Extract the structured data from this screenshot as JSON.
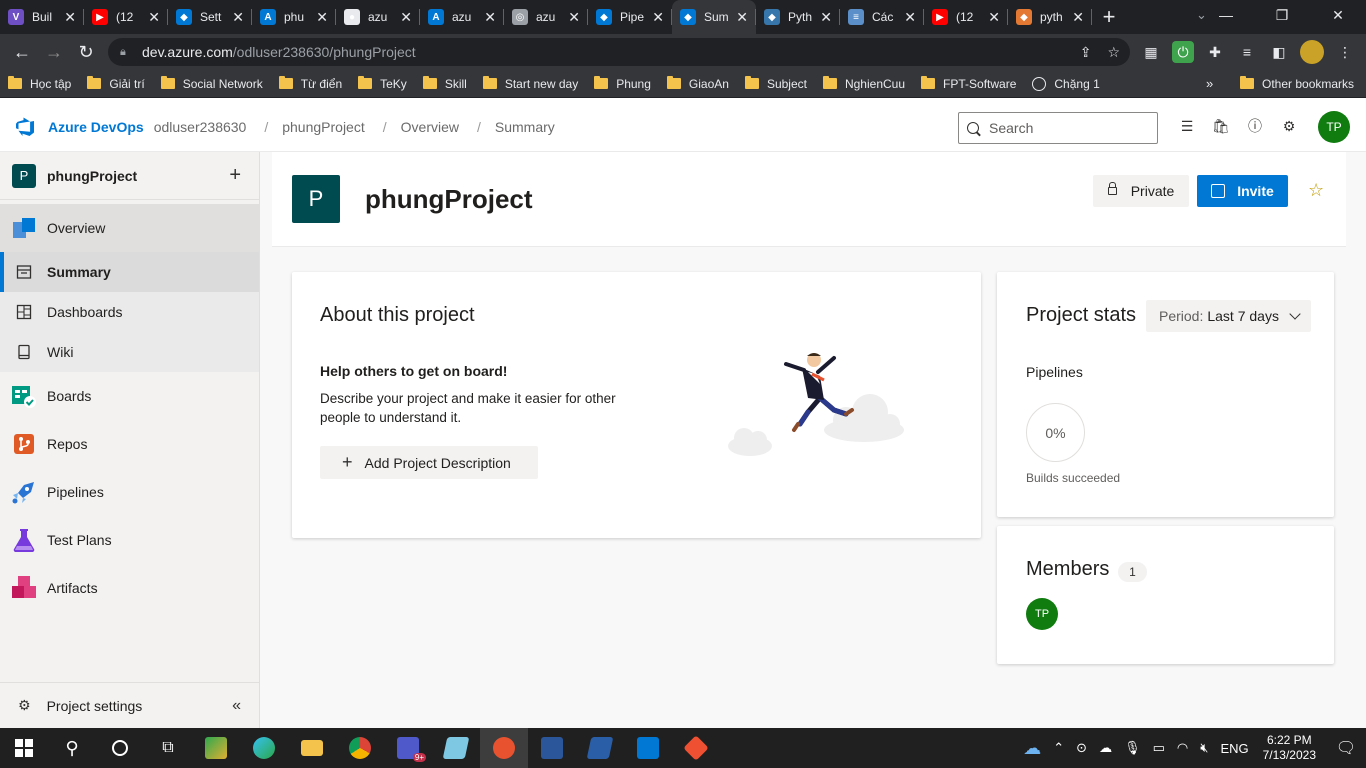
{
  "browser": {
    "tabs": [
      {
        "title": "Buil",
        "color": "#6e4fc4",
        "glyph": "V"
      },
      {
        "title": "(12",
        "color": "#ff0000",
        "glyph": "▶"
      },
      {
        "title": "Sett",
        "color": "#0078d4",
        "glyph": "◆"
      },
      {
        "title": "phu",
        "color": "#0078d4",
        "glyph": "A"
      },
      {
        "title": "azu",
        "color": "#e8eaed",
        "glyph": "●"
      },
      {
        "title": "azu",
        "color": "#0078d4",
        "glyph": "A"
      },
      {
        "title": "azu",
        "color": "#9aa0a6",
        "glyph": "◎"
      },
      {
        "title": "Pipe",
        "color": "#0078d4",
        "glyph": "◆"
      },
      {
        "title": "Sum",
        "color": "#0078d4",
        "glyph": "◆"
      },
      {
        "title": "Pyth",
        "color": "#3776ab",
        "glyph": "◆"
      },
      {
        "title": "Các",
        "color": "#5a8fc9",
        "glyph": "≡"
      },
      {
        "title": "(12",
        "color": "#ff0000",
        "glyph": "▶"
      },
      {
        "title": "pyth",
        "color": "#e37933",
        "glyph": "◆"
      }
    ],
    "active_tab_index": 8,
    "new_tab_symbol": "+",
    "url_host": "dev.azure.com",
    "url_path": "/odluser238630/phungProject",
    "bookmarks": [
      {
        "label": "Học tập",
        "kind": "folder"
      },
      {
        "label": "Giải trí",
        "kind": "folder"
      },
      {
        "label": "Social Network",
        "kind": "folder"
      },
      {
        "label": "Từ điển",
        "kind": "folder"
      },
      {
        "label": "TeKy",
        "kind": "folder"
      },
      {
        "label": "Skill",
        "kind": "folder"
      },
      {
        "label": "Start new day",
        "kind": "folder"
      },
      {
        "label": "Phung",
        "kind": "folder"
      },
      {
        "label": "GiaoAn",
        "kind": "folder"
      },
      {
        "label": "Subject",
        "kind": "folder"
      },
      {
        "label": "NghienCuu",
        "kind": "folder"
      },
      {
        "label": "FPT-Software",
        "kind": "folder"
      },
      {
        "label": "Chặng 1",
        "kind": "globe"
      }
    ],
    "bookmarks_more": "»",
    "other_bookmarks": "Other bookmarks"
  },
  "header": {
    "app_name": "Azure DevOps",
    "breadcrumb": [
      "odluser238630",
      "phungProject",
      "Overview",
      "Summary"
    ],
    "search_placeholder": "Search",
    "avatar_initials": "TP",
    "accent": "#0078d4"
  },
  "sidebar": {
    "project_initial": "P",
    "project_name": "phungProject",
    "add_symbol": "+",
    "items": [
      {
        "label": "Overview",
        "icon": "overview-icon",
        "kind": "group"
      },
      {
        "label": "Summary",
        "icon": "summary-icon",
        "kind": "sub",
        "selected": true
      },
      {
        "label": "Dashboards",
        "icon": "dashboards-icon",
        "kind": "sub"
      },
      {
        "label": "Wiki",
        "icon": "wiki-icon",
        "kind": "sub"
      },
      {
        "label": "Boards",
        "icon": "boards-icon",
        "kind": "big"
      },
      {
        "label": "Repos",
        "icon": "repos-icon",
        "kind": "big"
      },
      {
        "label": "Pipelines",
        "icon": "pipelines-icon",
        "kind": "big"
      },
      {
        "label": "Test Plans",
        "icon": "test-plans-icon",
        "kind": "big"
      },
      {
        "label": "Artifacts",
        "icon": "artifacts-icon",
        "kind": "big"
      }
    ],
    "settings_label": "Project settings",
    "collapse_symbol": "«"
  },
  "page": {
    "project_initial": "P",
    "title": "phungProject",
    "private_label": "Private",
    "invite_label": "Invite"
  },
  "about": {
    "title": "About this project",
    "subtitle": "Help others to get on board!",
    "description": "Describe your project and make it easier for other people to understand it.",
    "button_label": "Add Project Description"
  },
  "stats": {
    "title": "Project stats",
    "period_prefix": "Period:",
    "period_value": "Last 7 days",
    "pipelines_label": "Pipelines",
    "builds_percent": "0%",
    "builds_label": "Builds succeeded"
  },
  "members": {
    "title": "Members",
    "count": "1",
    "member_initials": "TP"
  },
  "taskbar": {
    "language": "ENG",
    "time": "6:22 PM",
    "date": "7/13/2023",
    "teams_badge": "9+"
  }
}
